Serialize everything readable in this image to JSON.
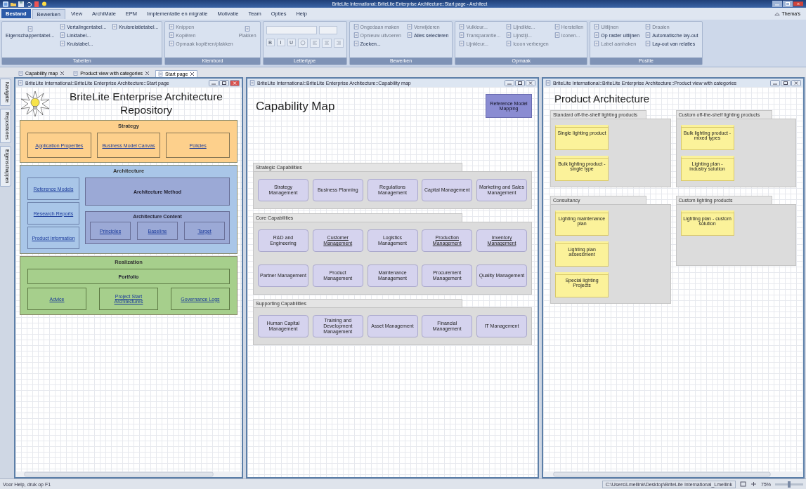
{
  "window": {
    "title": "BriteLite International::BriteLite Enterprise Architecture::Start page - Architect"
  },
  "ribbon_tabs": [
    {
      "label": "Bestand",
      "kind": "file",
      "selected": false
    },
    {
      "label": "Bewerken",
      "kind": "tab",
      "selected": true
    },
    {
      "label": "View",
      "kind": "tab",
      "selected": false
    },
    {
      "label": "ArchiMate",
      "kind": "tab",
      "selected": false
    },
    {
      "label": "EPM",
      "kind": "tab",
      "selected": false
    },
    {
      "label": "Implementatie en migratie",
      "kind": "tab",
      "selected": false
    },
    {
      "label": "Motivatie",
      "kind": "tab",
      "selected": false
    },
    {
      "label": "Team",
      "kind": "tab",
      "selected": false
    },
    {
      "label": "Opties",
      "kind": "tab",
      "selected": false
    },
    {
      "label": "Help",
      "kind": "tab",
      "selected": false
    }
  ],
  "themes": "Thema's",
  "ribbon_groups": [
    {
      "label": "Tabellen",
      "columns": [
        [
          {
            "label": "Eigenschappentabel...",
            "kind": "large",
            "disabled": false
          }
        ],
        [
          {
            "label": "Vertalingentabel...",
            "kind": "small",
            "disabled": false
          },
          {
            "label": "Linktabel...",
            "kind": "small",
            "disabled": false
          },
          {
            "label": "Kruistabel...",
            "kind": "small",
            "disabled": false
          }
        ],
        [
          {
            "label": "Kruisrelatietabel...",
            "kind": "small",
            "disabled": false
          }
        ]
      ]
    },
    {
      "label": "Klembord",
      "columns": [
        [
          {
            "label": "Knippen",
            "kind": "small",
            "disabled": true
          },
          {
            "label": "Kopiëren",
            "kind": "small",
            "disabled": true
          },
          {
            "label": "Opmaak kopiëren/plakken",
            "kind": "small",
            "disabled": true
          }
        ],
        [
          {
            "label": "Plakken",
            "kind": "large",
            "disabled": true
          }
        ]
      ]
    },
    {
      "label": "Lettertype",
      "columns": [
        [
          {
            "label": "B",
            "kind": "format",
            "disabled": true
          },
          {
            "label": "I",
            "kind": "format",
            "disabled": true
          },
          {
            "label": "U",
            "kind": "format",
            "disabled": true
          }
        ]
      ]
    },
    {
      "label": "Bewerken",
      "columns": [
        [
          {
            "label": "Ongedaan maken",
            "kind": "small",
            "disabled": true
          },
          {
            "label": "Opnieuw uitvoeren",
            "kind": "small",
            "disabled": true
          },
          {
            "label": "Zoeken...",
            "kind": "small",
            "disabled": false
          }
        ],
        [
          {
            "label": "Verwijderen",
            "kind": "small",
            "disabled": true
          },
          {
            "label": "Alles selecteren",
            "kind": "small",
            "disabled": false
          }
        ]
      ]
    },
    {
      "label": "Opmaak",
      "columns": [
        [
          {
            "label": "Vulkleur...",
            "kind": "small",
            "disabled": true
          },
          {
            "label": "Transparantie...",
            "kind": "small",
            "disabled": true
          },
          {
            "label": "Lijnkleur...",
            "kind": "small",
            "disabled": true
          }
        ],
        [
          {
            "label": "Lijndikte...",
            "kind": "small",
            "disabled": true
          },
          {
            "label": "Lijnstijl...",
            "kind": "small",
            "disabled": true
          },
          {
            "label": "Icoon verbergen",
            "kind": "small",
            "disabled": true
          }
        ],
        [
          {
            "label": "Herstellen",
            "kind": "small",
            "disabled": true
          },
          {
            "label": "Iconen...",
            "kind": "small",
            "disabled": true
          }
        ]
      ]
    },
    {
      "label": "Positie",
      "columns": [
        [
          {
            "label": "Uitlijnen",
            "kind": "small",
            "disabled": true
          },
          {
            "label": "Op raster uitlijnen",
            "kind": "small",
            "disabled": false
          },
          {
            "label": "Label aanhaken",
            "kind": "small",
            "disabled": true
          }
        ],
        [
          {
            "label": "Draaien",
            "kind": "small",
            "disabled": true
          },
          {
            "label": "Automatische lay-out",
            "kind": "small",
            "disabled": false
          },
          {
            "label": "Lay-out van relaties",
            "kind": "small",
            "disabled": false
          }
        ]
      ]
    }
  ],
  "side_tabs": [
    "Navigatie",
    "Repositories",
    "Eigenschappen"
  ],
  "doc_tabs": [
    {
      "label": "Capability map",
      "selected": false
    },
    {
      "label": "Product view with categories",
      "selected": false
    },
    {
      "label": "Start page",
      "selected": true
    }
  ],
  "start_page": {
    "title": "BriteLite International::BriteLite Enterprise Architecture::Start page",
    "heading": "BriteLite Enterprise Architecture Repository",
    "sections": [
      {
        "label": "Strategy",
        "kind": "links",
        "color": "#fdd08c",
        "links": [
          "Application Properties",
          "Business Model Canvas",
          "Policies"
        ]
      },
      {
        "label": "Architecture",
        "kind": "architecture",
        "color": "#a9c6e8",
        "links": [
          "Reference Models",
          "Research Reports",
          "Product Information"
        ],
        "method": "Architecture Method",
        "content": {
          "label": "Architecture Content",
          "links": [
            "Principles",
            "Baseline",
            "Target"
          ]
        }
      },
      {
        "label": "Realization",
        "kind": "realization",
        "color": "#a6cf8c",
        "portfolio": "Portfolio",
        "links": [
          "Advice",
          "Project Start Architectures",
          "Governance Logs"
        ]
      }
    ]
  },
  "capability_map": {
    "title": "BriteLite International::BriteLite Enterprise Architecture::Capability map",
    "heading": "Capability Map",
    "reference": "Reference Model Mapping",
    "groups": [
      {
        "label": "Strategic Capabilities",
        "rows": [
          [
            {
              "label": "Strategy Management",
              "linked": false
            },
            {
              "label": "Business Planning",
              "linked": false
            },
            {
              "label": "Regulations Management",
              "linked": false
            },
            {
              "label": "Capital Management",
              "linked": false
            },
            {
              "label": "Marketing and Sales Management",
              "linked": false
            }
          ]
        ]
      },
      {
        "label": "Core Capabilities",
        "rows": [
          [
            {
              "label": "R&D and Engineering",
              "linked": false
            },
            {
              "label": "Customer Management",
              "linked": true
            },
            {
              "label": "Logistics Management",
              "linked": false
            },
            {
              "label": "Production Management",
              "linked": true
            },
            {
              "label": "Inventory Management",
              "linked": true
            }
          ],
          [
            {
              "label": "Partner Management",
              "linked": false
            },
            {
              "label": "Product Management",
              "linked": false
            },
            {
              "label": "Maintenance Management",
              "linked": false
            },
            {
              "label": "Procurement Management",
              "linked": false
            },
            {
              "label": "Quality Management",
              "linked": false
            }
          ]
        ]
      },
      {
        "label": "Supporting Capabilities",
        "rows": [
          [
            {
              "label": "Human Capital Management",
              "linked": false
            },
            {
              "label": "Training and Development Management",
              "linked": false
            },
            {
              "label": "Asset Management",
              "linked": false
            },
            {
              "label": "Financial Management",
              "linked": false
            },
            {
              "label": "IT Management",
              "linked": false
            }
          ]
        ]
      }
    ]
  },
  "product_view": {
    "title": "BriteLite International::BriteLite Enterprise Architecture::Product view with categories",
    "heading": "Product Architecture",
    "categories": [
      {
        "label": "Standard off-the-shelf lighting products",
        "items": [
          "Single lighting product",
          "Bulk lighting product - single type"
        ]
      },
      {
        "label": "Custom off-the-shelf lighting products",
        "items": [
          "Bulk lighting product - mixed types",
          "Lighting plan - industry solution"
        ]
      },
      {
        "label": "Consultancy",
        "items": [
          "Lighting maintenance plan",
          "Lighting plan assessment",
          "Special lighting Projects"
        ]
      },
      {
        "label": "Custom lighting products",
        "items": [
          "Lighting plan - custom solution"
        ]
      }
    ]
  },
  "status_bar": {
    "help": "Voor Help, druk op F1",
    "path": "C:\\Users\\Lmellink\\Desktop\\BriteLite International_Lmellink",
    "zoom": "75%",
    "zoom_slider": {
      "level": 0.5
    }
  }
}
